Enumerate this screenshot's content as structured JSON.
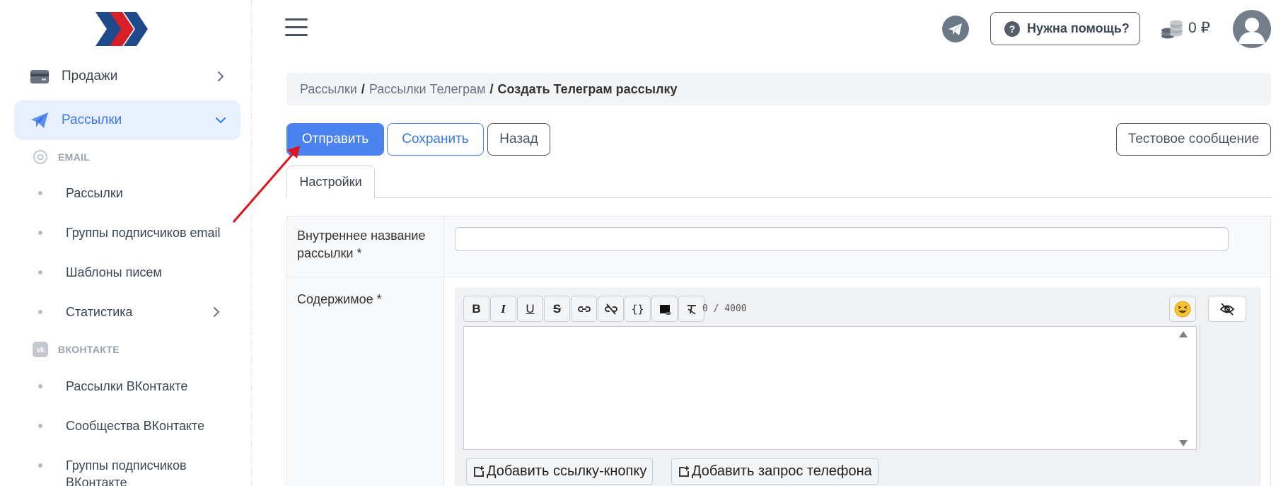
{
  "sidebar": {
    "items": [
      {
        "label": "Продажи",
        "icon": "card-icon"
      },
      {
        "label": "Рассылки",
        "icon": "paper-plane-icon",
        "active": true
      }
    ],
    "sections": [
      {
        "label": "EMAIL",
        "icon": "at-icon"
      },
      {
        "label": "ВКОНТАКТЕ",
        "icon": "vk-icon"
      }
    ],
    "email_items": [
      "Рассылки",
      "Группы подписчиков email",
      "Шаблоны писем",
      "Статистика"
    ],
    "vk_items": [
      "Рассылки ВКонтакте",
      "Сообщества ВКонтакте",
      "Группы подписчиков ВКонтакте"
    ]
  },
  "topbar": {
    "help_label": "Нужна помощь?",
    "balance": "0 ₽"
  },
  "breadcrumb": {
    "items": [
      "Рассылки",
      "Рассылки Телеграм"
    ],
    "current": "Создать Телеграм рассылку"
  },
  "actions": {
    "send": "Отправить",
    "save": "Сохранить",
    "back": "Назад",
    "test": "Тестовое сообщение"
  },
  "tabs": [
    "Настройки"
  ],
  "form": {
    "name_label_line1": "Внутреннее название",
    "name_label_line2": "рассылки *",
    "name_value": "",
    "content_label": "Содержимое *",
    "counter": "0 / 4000",
    "toolbar": [
      "B",
      "I",
      "U",
      "S",
      "link",
      "unlink",
      "{}",
      "block",
      "clear-format"
    ],
    "add_link_button": "Добавить ссылку-кнопку",
    "add_phone_request": "Добавить запрос телефона"
  },
  "colors": {
    "accent": "#4a82f0",
    "active_bg": "#e8f0fd",
    "annotation_arrow": "#e0141e"
  }
}
